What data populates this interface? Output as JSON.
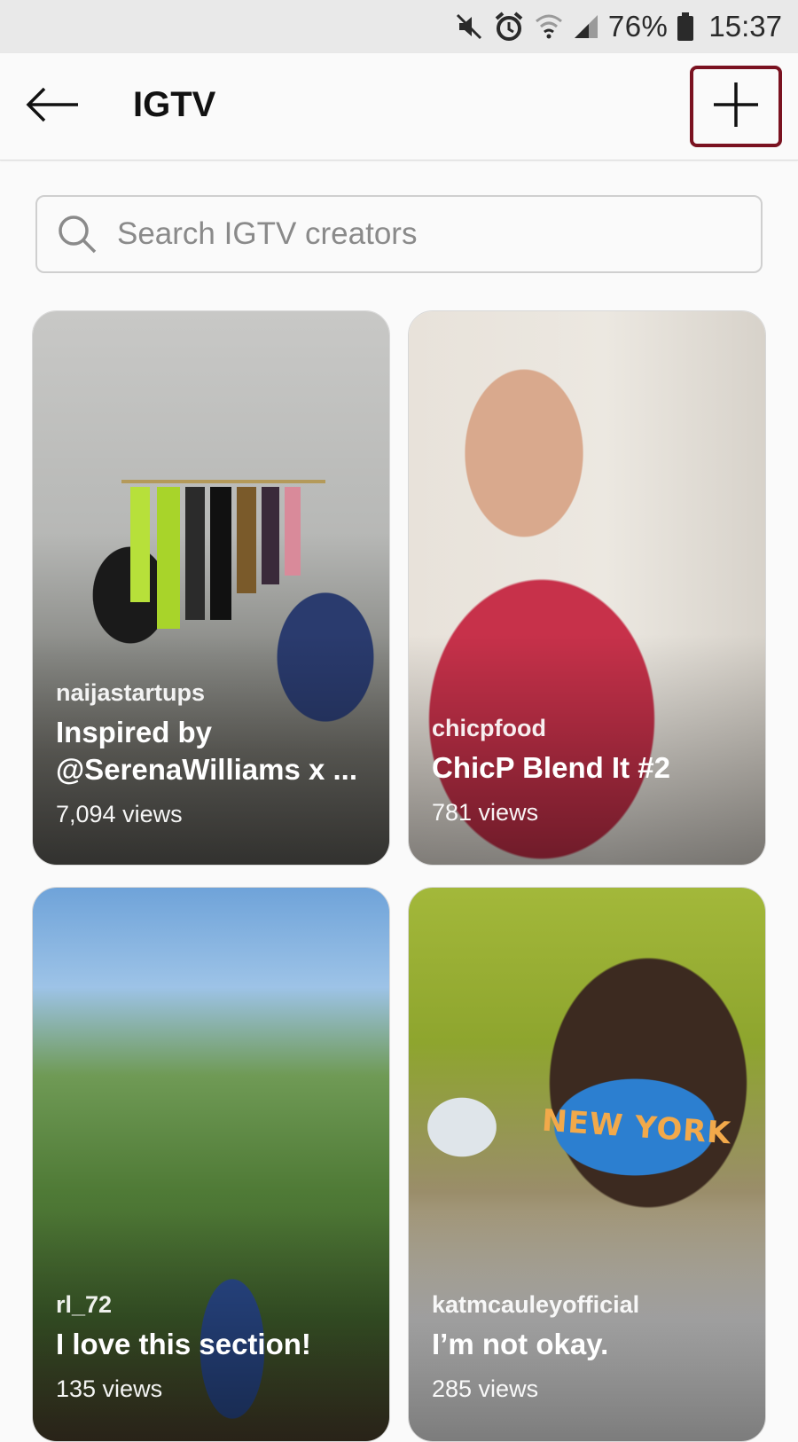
{
  "status_bar": {
    "battery": "76%",
    "time": "15:37",
    "icons": [
      "mute-icon",
      "alarm-icon",
      "wifi-icon",
      "signal-icon",
      "battery-icon"
    ]
  },
  "header": {
    "title": "IGTV",
    "back_icon": "back-arrow-icon",
    "add_icon": "plus-icon",
    "add_highlight_color": "#7a1220"
  },
  "search": {
    "placeholder": "Search IGTV creators",
    "value": ""
  },
  "videos": [
    {
      "creator": "naijastartups",
      "title_line1": "Inspired by",
      "title_line2": "@SerenaWilliams x ...",
      "views": "7,094 views"
    },
    {
      "creator": "chicpfood",
      "title_line1": "ChicP Blend It #2",
      "title_line2": "",
      "views": "781 views"
    },
    {
      "creator": "rl_72",
      "title_line1": "I love this section!",
      "title_line2": "",
      "views": "135 views"
    },
    {
      "creator": "katmcauleyofficial",
      "title_line1": "I’m not okay.",
      "title_line2": "",
      "views": "285 views",
      "thumb_text": "NEW YORK"
    }
  ]
}
